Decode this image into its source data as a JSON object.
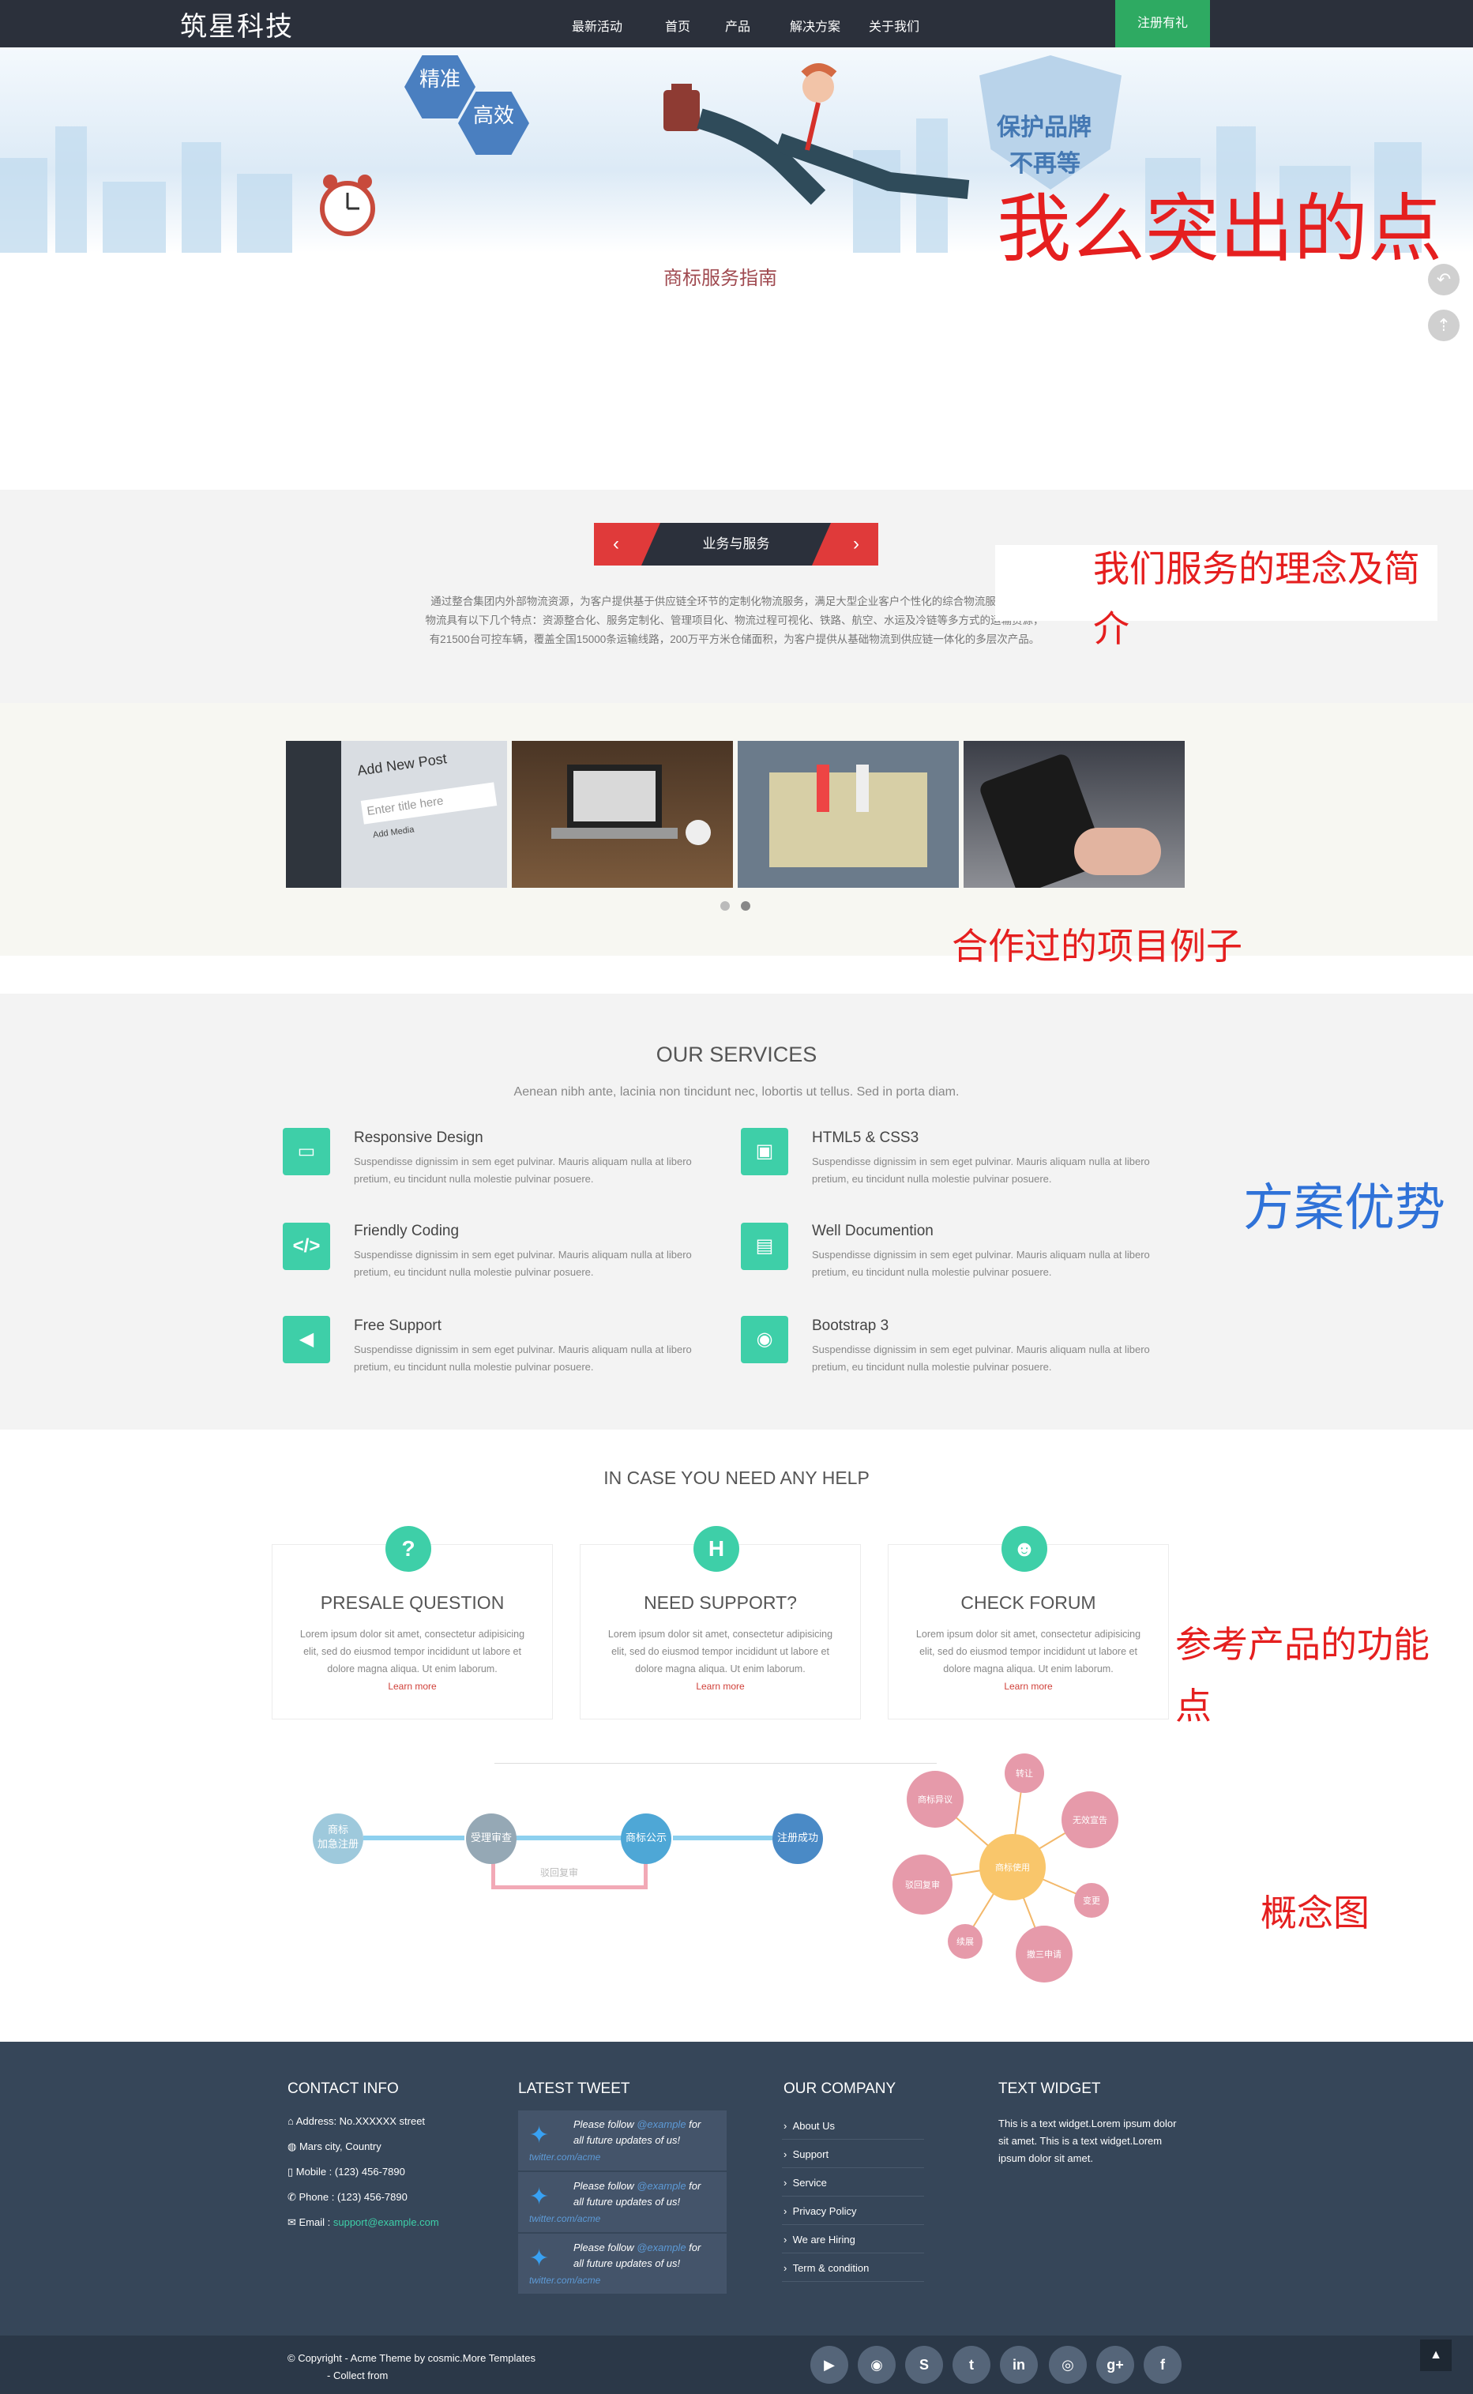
{
  "header": {
    "logo": "筑星科技",
    "nav": [
      "最新活动",
      "首页",
      "产品",
      "解决方案",
      "关于我们"
    ],
    "cta": "注册有礼"
  },
  "banner": {
    "hex1": "精准",
    "hex2": "高效",
    "shield_line1": "保护品牌",
    "shield_line2": "不再等",
    "highlight": "我么突出的点",
    "guide": "商标服务指南"
  },
  "business": {
    "title": "业务与服务",
    "para": [
      "通过整合集团内外部物流资源，为客户提供基于供应链全环节的定制化物流服务，满足大型企业客户个性化的综合物流服务需求，",
      "物流具有以下几个特点：资源整合化、服务定制化、管理项目化、物流过程可视化、铁路、航空、水运及冷链等多方式的运输资源，",
      "有21500台可控车辆，覆盖全国15000条运输线路，200万平方米仓储面积，为客户提供从基础物流到供应链一体化的多层次产品。"
    ],
    "note": "我们服务的理念及简介",
    "note_line1": "我们服务的理念及简",
    "note_line2": "介"
  },
  "portfolio": {
    "thumb_text": {
      "title": "Add New Post",
      "placeholder": "Enter title here",
      "media": "Add Media"
    },
    "note": "合作过的项目例子"
  },
  "services": {
    "title": "OUR SERVICES",
    "subtitle": "Aenean nibh ante, lacinia non tincidunt nec, lobortis ut tellus. Sed in porta diam.",
    "note": "方案优势",
    "items": [
      {
        "name": "Responsive Design",
        "icon": "monitor-icon"
      },
      {
        "name": "HTML5 & CSS3",
        "icon": "gift-icon"
      },
      {
        "name": "Friendly Coding",
        "icon": "code-icon"
      },
      {
        "name": "Well Documention",
        "icon": "book-icon"
      },
      {
        "name": "Free Support",
        "icon": "megaphone-icon"
      },
      {
        "name": "Bootstrap 3",
        "icon": "eye-icon"
      }
    ],
    "desc_line1": "Suspendisse dignissim in sem eget pulvinar. Mauris aliquam nulla at libero",
    "desc_line2": "pretium, eu tincidunt nulla molestie pulvinar posuere."
  },
  "help": {
    "title": "IN CASE YOU NEED ANY HELP",
    "note_line1": "参考产品的功能",
    "note_line2": "点",
    "cards": [
      {
        "title": "PRESALE QUESTION",
        "icon": "question-icon"
      },
      {
        "title": "NEED SUPPORT?",
        "icon": "hospital-icon"
      },
      {
        "title": "CHECK FORUM",
        "icon": "users-icon"
      }
    ],
    "desc": [
      "Lorem ipsum dolor sit amet, consectetur adipisicing",
      "elit, sed do eiusmod tempor incididunt ut labore et",
      "dolore magna aliqua. Ut enim laborum."
    ],
    "more": "Learn more"
  },
  "flow": {
    "nodes": [
      "商标\n加急注册",
      "受理审查",
      "商标公示",
      "注册成功"
    ],
    "return": "驳回复审",
    "mind_center": "商标使用",
    "mind_nodes": [
      "商标异议",
      "转让",
      "无效宣告",
      "驳回复审",
      "变更",
      "续展",
      "撤三申请"
    ],
    "note": "概念图"
  },
  "footer": {
    "contact": {
      "title": "CONTACT INFO",
      "address": "Address: No.XXXXXX street",
      "city": "Mars city, Country",
      "mobile": "Mobile : (123) 456-7890",
      "phone": "Phone : (123) 456-7890",
      "email_label": "Email : ",
      "email": "support@example.com"
    },
    "tweet": {
      "title": "LATEST TWEET",
      "text1": "Please follow ",
      "handle": "@example",
      "text2": " for",
      "text3": "all future updates of us!",
      "link": "twitter.com/acme"
    },
    "company": {
      "title": "OUR COMPANY",
      "links": [
        "About Us",
        "Support",
        "Service",
        "Privacy Policy",
        "We are Hiring",
        "Term & condition"
      ]
    },
    "widget": {
      "title": "TEXT WIDGET",
      "lines": [
        "This is a text widget.Lorem ipsum dolor",
        "sit amet. This is a text widget.Lorem",
        "ipsum dolor sit amet."
      ]
    },
    "copyright": "© Copyright - Acme Theme by cosmic.More Templates",
    "collect": "- Collect from",
    "social": [
      "youtube-icon",
      "github-icon",
      "skype-icon",
      "twitter-icon",
      "linkedin-icon",
      "dribbble-icon",
      "google-plus-icon",
      "facebook-icon"
    ],
    "social_glyphs": [
      "▶",
      "◉",
      "S",
      "t",
      "in",
      "◎",
      "g+",
      "f"
    ],
    "scroll_top": "▲"
  }
}
